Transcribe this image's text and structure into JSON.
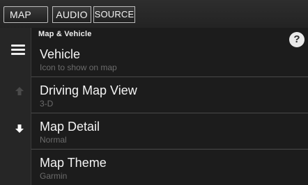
{
  "tabs": [
    {
      "label": "MAP"
    },
    {
      "label": "AUDIO"
    },
    {
      "label": "SOURCE"
    }
  ],
  "header": {
    "section_title": "Map & Vehicle",
    "help_glyph": "?"
  },
  "icons": {
    "menu": "hamburger-menu-icon",
    "scroll_up": "arrow-up-icon",
    "scroll_down": "arrow-down-icon",
    "help": "help-icon"
  },
  "list": {
    "items": [
      {
        "title": "Vehicle",
        "subtitle": "Icon to show on map"
      },
      {
        "title": "Driving Map View",
        "subtitle": "3-D"
      },
      {
        "title": "Map Detail",
        "subtitle": "Normal"
      },
      {
        "title": "Map Theme",
        "subtitle": "Garmin"
      }
    ]
  },
  "colors": {
    "background": "#1d1d1d",
    "text": "#f4f4f4",
    "subtext": "#6b6b6b",
    "divider": "#4a4a4a",
    "arrow_active": "#ffffff",
    "arrow_disabled": "#4a4a4a"
  }
}
